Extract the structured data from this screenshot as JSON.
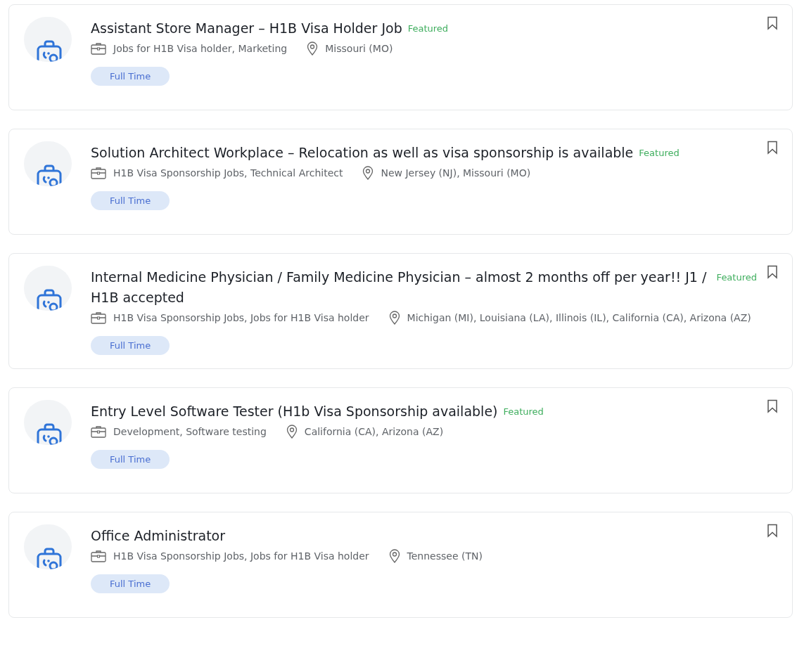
{
  "jobs": [
    {
      "title": "Assistant Store Manager – H1B Visa Holder Job",
      "featured_label": "Featured",
      "categories": "Jobs for H1B Visa holder, Marketing",
      "location": "Missouri (MO)",
      "job_type": "Full Time",
      "bookmarked": false
    },
    {
      "title": "Solution Architect Workplace – Relocation as well as visa sponsorship is available",
      "featured_label": "Featured",
      "categories": "H1B Visa Sponsorship Jobs, Technical Architect",
      "location": "New Jersey (NJ), Missouri (MO)",
      "job_type": "Full Time",
      "bookmarked": false
    },
    {
      "title": "Internal Medicine Physician / Family Medicine Physician – almost 2 months off per year!! J1 / H1B accepted",
      "featured_label": "Featured",
      "categories": "H1B Visa Sponsorship Jobs, Jobs for H1B Visa holder",
      "location": "Michigan (MI), Louisiana (LA), Illinois (IL), California (CA), Arizona (AZ)",
      "job_type": "Full Time",
      "bookmarked": false
    },
    {
      "title": "Entry Level Software Tester (H1b Visa Sponsorship available)",
      "featured_label": "Featured",
      "categories": "Development, Software testing",
      "location": "California (CA), Arizona (AZ)",
      "job_type": "Full Time",
      "bookmarked": false
    },
    {
      "title": "Office Administrator",
      "categories": "H1B Visa Sponsorship Jobs, Jobs for H1B Visa holder",
      "location": "Tennessee (TN)",
      "job_type": "Full Time",
      "bookmarked": false
    }
  ]
}
